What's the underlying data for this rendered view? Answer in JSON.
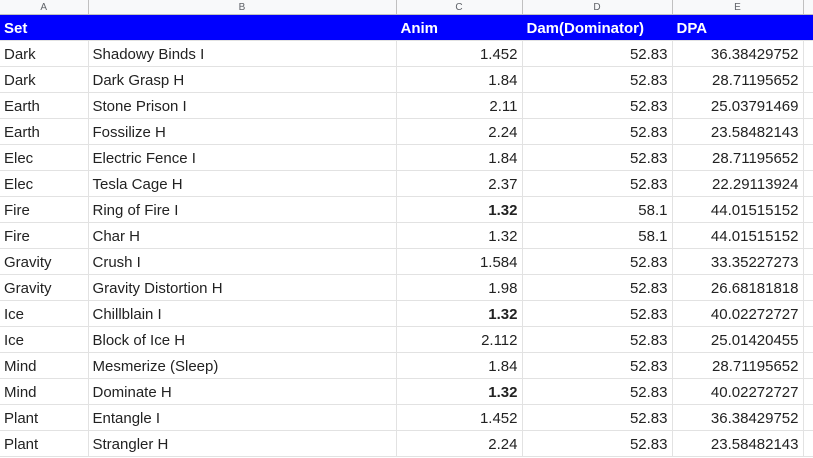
{
  "columns": [
    "A",
    "B",
    "C",
    "D",
    "E"
  ],
  "headers": {
    "set": "Set",
    "power": "",
    "anim": "Anim",
    "damage": "Dam(Dominator)",
    "dpa": "DPA"
  },
  "rows": [
    {
      "set": "Dark",
      "power": "Shadowy Binds I",
      "anim": "1.452",
      "anim_bold": false,
      "damage": "52.83",
      "dpa": "36.38429752"
    },
    {
      "set": "Dark",
      "power": "Dark Grasp H",
      "anim": "1.84",
      "anim_bold": false,
      "damage": "52.83",
      "dpa": "28.71195652"
    },
    {
      "set": "Earth",
      "power": "Stone Prison I",
      "anim": "2.11",
      "anim_bold": false,
      "damage": "52.83",
      "dpa": "25.03791469"
    },
    {
      "set": "Earth",
      "power": "Fossilize H",
      "anim": "2.24",
      "anim_bold": false,
      "damage": "52.83",
      "dpa": "23.58482143"
    },
    {
      "set": "Elec",
      "power": "Electric Fence I",
      "anim": "1.84",
      "anim_bold": false,
      "damage": "52.83",
      "dpa": "28.71195652"
    },
    {
      "set": "Elec",
      "power": "Tesla Cage H",
      "anim": "2.37",
      "anim_bold": false,
      "damage": "52.83",
      "dpa": "22.29113924"
    },
    {
      "set": "Fire",
      "power": "Ring of Fire I",
      "anim": "1.32",
      "anim_bold": true,
      "damage": "58.1",
      "dpa": "44.01515152"
    },
    {
      "set": "Fire",
      "power": "Char H",
      "anim": "1.32",
      "anim_bold": false,
      "damage": "58.1",
      "dpa": "44.01515152"
    },
    {
      "set": "Gravity",
      "power": "Crush I",
      "anim": "1.584",
      "anim_bold": false,
      "damage": "52.83",
      "dpa": "33.35227273"
    },
    {
      "set": "Gravity",
      "power": "Gravity Distortion H",
      "anim": "1.98",
      "anim_bold": false,
      "damage": "52.83",
      "dpa": "26.68181818"
    },
    {
      "set": "Ice",
      "power": "Chillblain I",
      "anim": "1.32",
      "anim_bold": true,
      "damage": "52.83",
      "dpa": "40.02272727"
    },
    {
      "set": "Ice",
      "power": "Block of Ice H",
      "anim": "2.112",
      "anim_bold": false,
      "damage": "52.83",
      "dpa": "25.01420455"
    },
    {
      "set": "Mind",
      "power": "Mesmerize (Sleep)",
      "anim": "1.84",
      "anim_bold": false,
      "damage": "52.83",
      "dpa": "28.71195652"
    },
    {
      "set": "Mind",
      "power": "Dominate H",
      "anim": "1.32",
      "anim_bold": true,
      "damage": "52.83",
      "dpa": "40.02272727"
    },
    {
      "set": "Plant",
      "power": "Entangle I",
      "anim": "1.452",
      "anim_bold": false,
      "damage": "52.83",
      "dpa": "36.38429752"
    },
    {
      "set": "Plant",
      "power": "Strangler H",
      "anim": "2.24",
      "anim_bold": false,
      "damage": "52.83",
      "dpa": "23.58482143"
    }
  ],
  "colors": {
    "header_background": "#0000ff",
    "header_text": "#ffffff",
    "grid_line": "#e2e2e2"
  }
}
